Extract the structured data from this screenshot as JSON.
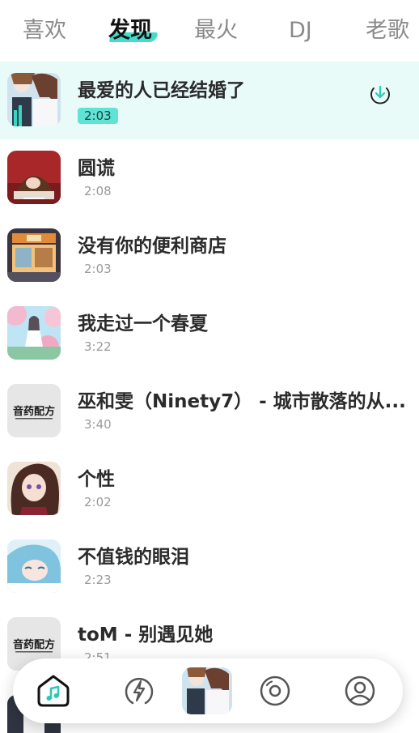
{
  "tabs": [
    "喜欢",
    "发现",
    "最火",
    "DJ",
    "老歌"
  ],
  "active_tab": "发现",
  "songs": [
    {
      "title": "最爱的人已经结婚了",
      "duration": "2:03"
    },
    {
      "title": "圆谎",
      "duration": "2:08"
    },
    {
      "title": "没有你的便利商店",
      "duration": "2:03"
    },
    {
      "title": "我走过一个春夏",
      "duration": "3:22"
    },
    {
      "title": "巫和雯（Ninety7） - 城市散落的从...",
      "duration": "3:40"
    },
    {
      "title": "个性",
      "duration": "2:02"
    },
    {
      "title": "不值钱的眼泪",
      "duration": "2:23"
    },
    {
      "title": "toM - 别遇见她",
      "duration": "2:51"
    }
  ],
  "cover_text": {
    "music_label": "音药配方"
  },
  "nav": {
    "items": [
      "music-icon",
      "lightning-icon",
      "now-playing-cover",
      "disc-icon",
      "user-icon"
    ]
  },
  "colors": {
    "accent": "#42dccd",
    "active_row_bg": "#e8fbf9",
    "duration_badge": "#5ee3d4"
  }
}
